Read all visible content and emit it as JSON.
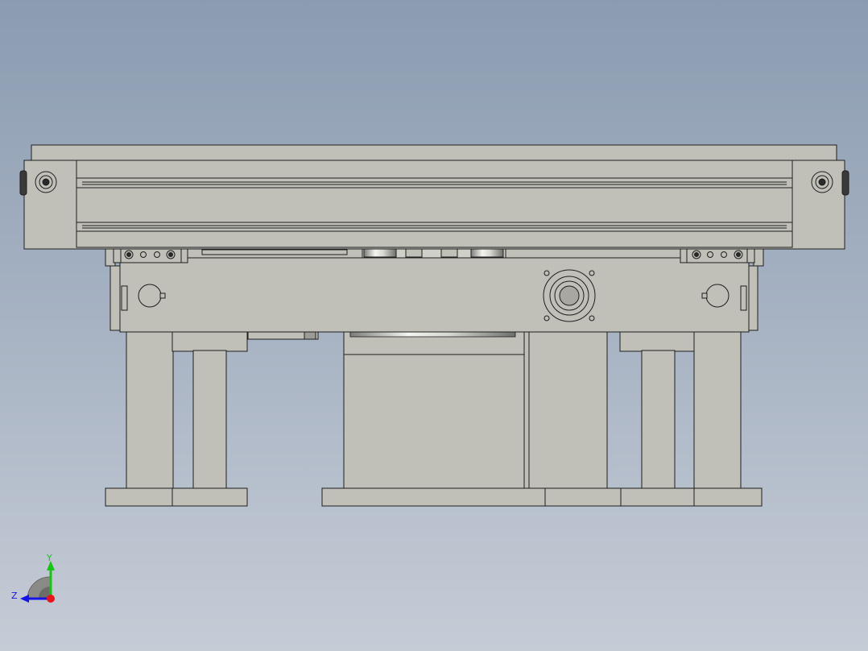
{
  "viewport": {
    "background_top": "#8b9cb1",
    "background_bottom": "#c6ccd6"
  },
  "model": {
    "view": "front",
    "part_fill": "#c0c0b8",
    "edge_color": "#1e1e1e",
    "components": [
      "rail-profile",
      "left-end-cap",
      "right-end-cap",
      "carriage-plate",
      "left-bracket",
      "right-bracket",
      "motor-block",
      "motor-flange",
      "feet"
    ]
  },
  "triad": {
    "x_label": "",
    "y_label": "Y",
    "z_label": "Z",
    "x_color": "#e8141b",
    "y_color": "#19c419",
    "z_color": "#1414e6"
  }
}
